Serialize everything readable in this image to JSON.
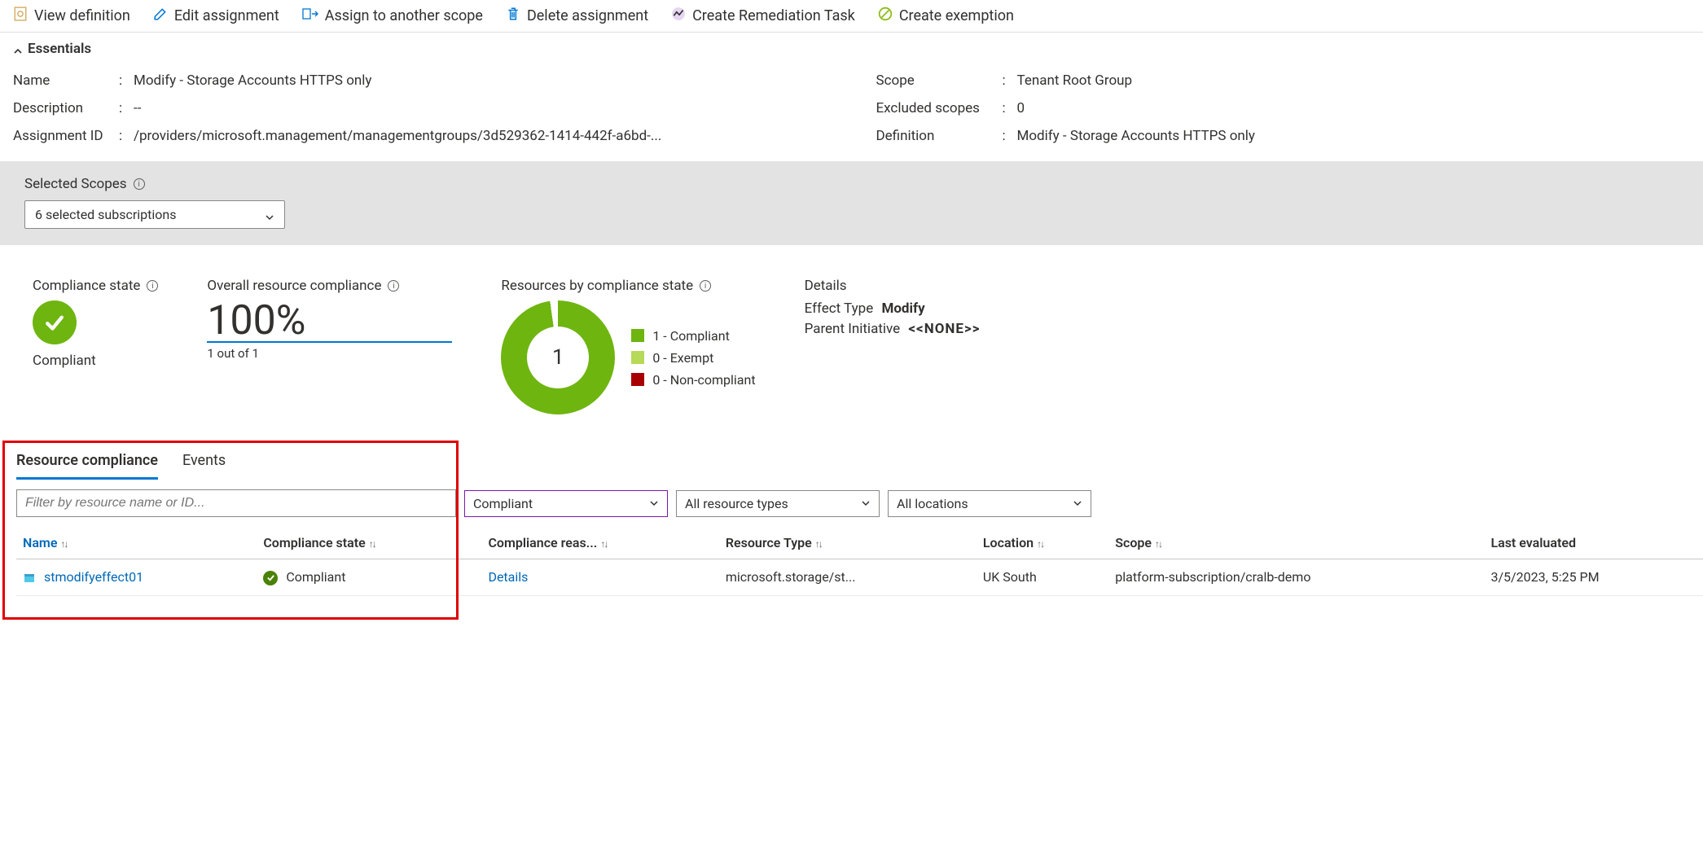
{
  "toolbar": {
    "view_definition": "View definition",
    "edit_assignment": "Edit assignment",
    "assign_scope": "Assign to another scope",
    "delete_assignment": "Delete assignment",
    "create_remediation": "Create Remediation Task",
    "create_exemption": "Create exemption"
  },
  "essentials": {
    "header": "Essentials",
    "left": {
      "name_label": "Name",
      "name_value": "Modify - Storage Accounts HTTPS only",
      "description_label": "Description",
      "description_value": "--",
      "assignment_id_label": "Assignment ID",
      "assignment_id_value": "/providers/microsoft.management/managementgroups/3d529362-1414-442f-a6bd-..."
    },
    "right": {
      "scope_label": "Scope",
      "scope_value": "Tenant Root Group",
      "excluded_label": "Excluded scopes",
      "excluded_value": "0",
      "definition_label": "Definition",
      "definition_value": "Modify - Storage Accounts HTTPS only"
    }
  },
  "selected_scopes": {
    "label": "Selected Scopes",
    "dropdown_value": "6 selected subscriptions"
  },
  "compliance_state": {
    "title": "Compliance state",
    "value": "Compliant"
  },
  "overall_compliance": {
    "title": "Overall resource compliance",
    "percent": "100%",
    "out_of": "1 out of 1"
  },
  "resources_by_state": {
    "title": "Resources by compliance state",
    "center": "1",
    "legend": {
      "compliant": "1 - Compliant",
      "exempt": "0 - Exempt",
      "noncompliant": "0 - Non-compliant"
    }
  },
  "details_block": {
    "title": "Details",
    "effect_type_label": "Effect Type",
    "effect_type_value": "Modify",
    "parent_label": "Parent Initiative",
    "parent_value": "<<NONE>>"
  },
  "tabs": {
    "resource_compliance": "Resource compliance",
    "events": "Events"
  },
  "filters": {
    "filter_placeholder": "Filter by resource name or ID...",
    "compliant_dd": "Compliant",
    "restype_dd": "All resource types",
    "location_dd": "All locations"
  },
  "table": {
    "headers": {
      "name": "Name",
      "compliance_state": "Compliance state",
      "compliance_reason": "Compliance reas...",
      "resource_type": "Resource Type",
      "location": "Location",
      "scope": "Scope",
      "last_evaluated": "Last evaluated"
    },
    "rows": [
      {
        "name": "stmodifyeffect01",
        "compliance_state": "Compliant",
        "compliance_reason": "Details",
        "resource_type": "microsoft.storage/st...",
        "location": "UK South",
        "scope": "platform-subscription/cralb-demo",
        "last_evaluated": "3/5/2023, 5:25 PM"
      }
    ]
  },
  "chart_data": {
    "type": "pie",
    "title": "Resources by compliance state",
    "categories": [
      "Compliant",
      "Exempt",
      "Non-compliant"
    ],
    "values": [
      1,
      0,
      0
    ],
    "colors": [
      "#6eb510",
      "#b6d957",
      "#a80000"
    ],
    "center_label": "1"
  }
}
